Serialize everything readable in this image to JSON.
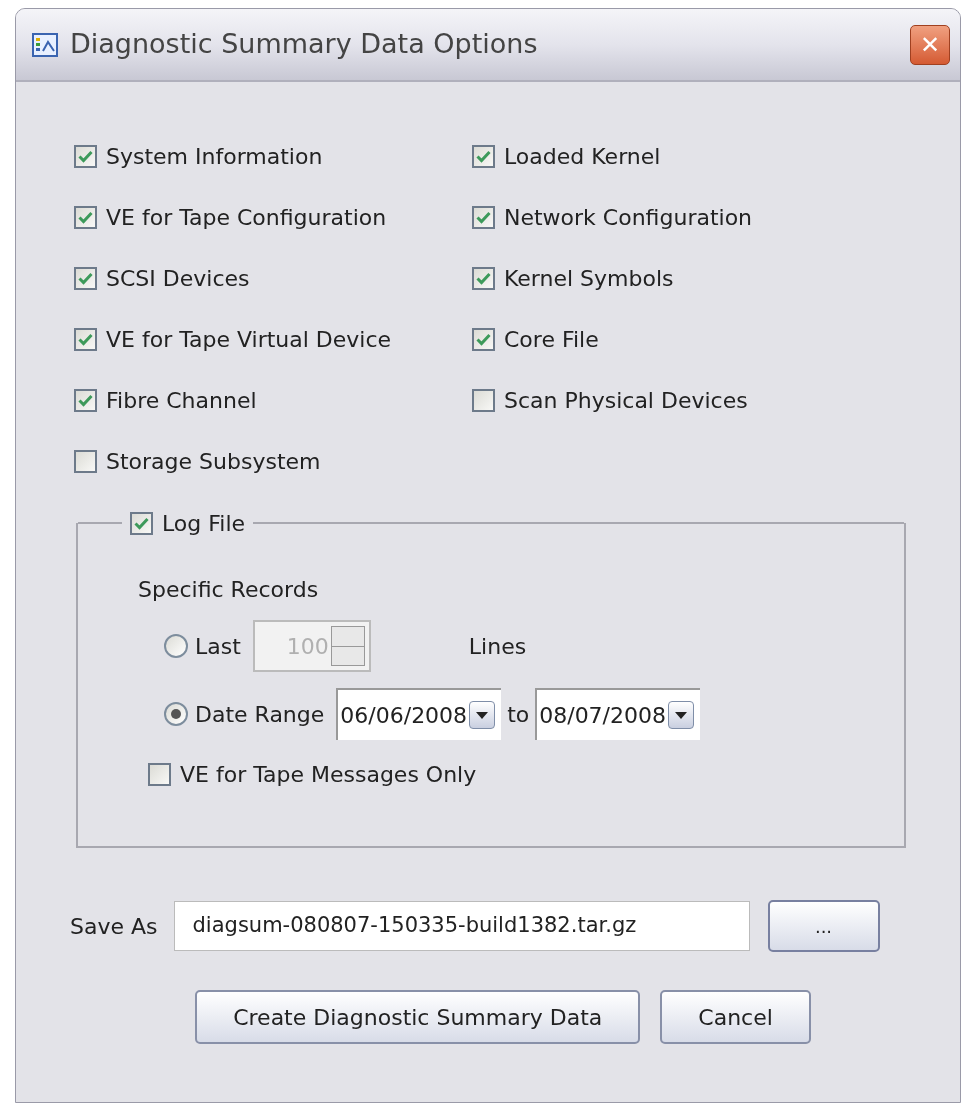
{
  "window": {
    "title": "Diagnostic Summary Data Options",
    "close": "✕"
  },
  "options_left": [
    {
      "label": "System Information",
      "checked": true
    },
    {
      "label": "VE for Tape Configuration",
      "checked": true
    },
    {
      "label": "SCSI Devices",
      "checked": true
    },
    {
      "label": "VE for Tape Virtual Device",
      "checked": true
    },
    {
      "label": "Fibre Channel",
      "checked": true
    },
    {
      "label": "Storage Subsystem",
      "checked": false
    }
  ],
  "options_right": [
    {
      "label": "Loaded Kernel",
      "checked": true
    },
    {
      "label": "Network Configuration",
      "checked": true
    },
    {
      "label": "Kernel Symbols",
      "checked": true
    },
    {
      "label": "Core File",
      "checked": true
    },
    {
      "label": "Scan Physical Devices",
      "checked": false
    }
  ],
  "log_file": {
    "label": "Log File",
    "checked": true,
    "heading": "Specific Records",
    "modes": [
      {
        "kind": "last",
        "label": "Last",
        "selected": false,
        "value": "100",
        "unit": "Lines"
      },
      {
        "kind": "range",
        "label": "Date Range",
        "selected": true,
        "from": "06/06/2008",
        "to_label": "to",
        "to": "08/07/2008"
      }
    ],
    "messages_only": {
      "label": "VE for Tape Messages Only",
      "checked": false
    }
  },
  "save_as": {
    "label": "Save As",
    "value": "diagsum-080807-150335-build1382.tar.gz",
    "browse": "..."
  },
  "buttons": [
    "Create Diagnostic Summary Data",
    "Cancel"
  ]
}
